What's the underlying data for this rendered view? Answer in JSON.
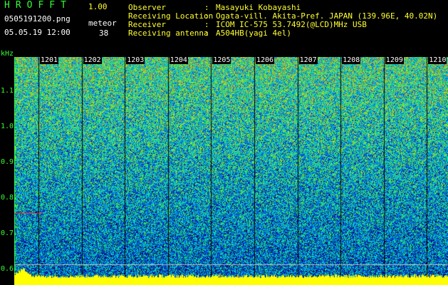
{
  "header": {
    "app_title": "HROFFT",
    "version": "1.00",
    "filename": "0505191200.png",
    "datetime": "05.05.19 12:00",
    "meteor_label": "meteor",
    "meteor_count": "38"
  },
  "info": [
    {
      "key": "Observer",
      "sep": ":",
      "value": "Masayuki Kobayashi"
    },
    {
      "key": "Receiving Location",
      "sep": ":",
      "value": "Ogata-vill. Akita-Pref. JAPAN (139.96E, 40.02N)"
    },
    {
      "key": "Receiver",
      "sep": ":",
      "value": "ICOM IC-575 53.7492(@LCD)MHz USB"
    },
    {
      "key": "Receiving antenna",
      "sep": ":",
      "value": "A504HB(yagi 4el)"
    }
  ],
  "plot": {
    "y_unit": "kHz",
    "y_ticks": [
      "1.1",
      "1.0",
      "0.9",
      "0.8",
      "0.7",
      "0.6"
    ],
    "time_labels": [
      "1201",
      "1202",
      "1203",
      "1204",
      "1205",
      "1206",
      "1207",
      "1208",
      "1209",
      "1210"
    ],
    "colors": {
      "axis": "#33ff33",
      "trace": "#ffff00",
      "marker": "#ff3333"
    }
  }
}
